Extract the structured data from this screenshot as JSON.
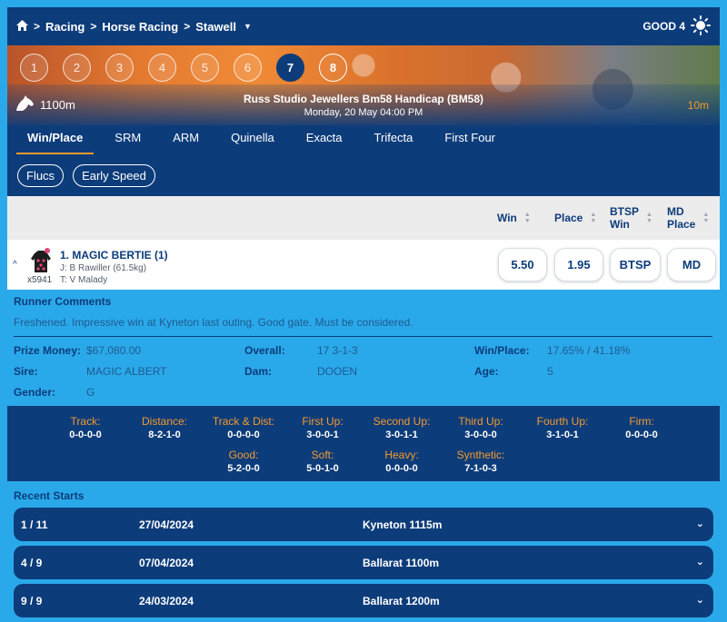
{
  "breadcrumb": {
    "items": [
      "Racing",
      "Horse Racing",
      "Stawell"
    ]
  },
  "track_condition": "GOOD 4",
  "race_numbers": [
    "1",
    "2",
    "3",
    "4",
    "5",
    "6",
    "7",
    "8"
  ],
  "active_race": "7",
  "race": {
    "distance": "1100m",
    "title": "Russ Studio Jewellers Bm58 Handicap (BM58)",
    "datetime": "Monday, 20 May 04:00 PM",
    "countdown": "10m"
  },
  "tabs": [
    "Win/Place",
    "SRM",
    "ARM",
    "Quinella",
    "Exacta",
    "Trifecta",
    "First Four"
  ],
  "filters": [
    "Flucs",
    "Early Speed"
  ],
  "odds_headers": {
    "win": "Win",
    "place": "Place",
    "btsp_1": "BTSP",
    "btsp_2": "Win",
    "md_1": "MD",
    "md_2": "Place"
  },
  "runner": {
    "name": "1. MAGIC BERTIE (1)",
    "jockey": "J: B Rawiller (61.5kg)",
    "trainer": "T: V Malady",
    "id": "x5941",
    "odds": {
      "win": "5.50",
      "place": "1.95",
      "btsp": "BTSP",
      "md": "MD"
    }
  },
  "comments": {
    "title": "Runner Comments",
    "text": "Freshened. Impressive win at Kyneton last outing. Good gate. Must be considered."
  },
  "details": {
    "prize_money_label": "Prize Money:",
    "prize_money": "$67,080.00",
    "overall_label": "Overall:",
    "overall": "17 3-1-3",
    "winplace_label": "Win/Place:",
    "winplace": "17.65% / 41.18%",
    "sire_label": "Sire:",
    "sire": "MAGIC ALBERT",
    "dam_label": "Dam:",
    "dam": "DOOEN",
    "age_label": "Age:",
    "age": "5",
    "gender_label": "Gender:",
    "gender": "G"
  },
  "stats": [
    {
      "label": "Track:",
      "value": "0-0-0-0"
    },
    {
      "label": "Distance:",
      "value": "8-2-1-0"
    },
    {
      "label": "Track & Dist:",
      "value": "0-0-0-0"
    },
    {
      "label": "First Up:",
      "value": "3-0-0-1"
    },
    {
      "label": "Second Up:",
      "value": "3-0-1-1"
    },
    {
      "label": "Third Up:",
      "value": "3-0-0-0"
    },
    {
      "label": "Fourth Up:",
      "value": "3-1-0-1"
    },
    {
      "label": "Firm:",
      "value": "0-0-0-0"
    },
    {
      "label": "Good:",
      "value": "5-2-0-0"
    },
    {
      "label": "Soft:",
      "value": "5-0-1-0"
    },
    {
      "label": "Heavy:",
      "value": "0-0-0-0"
    },
    {
      "label": "Synthetic:",
      "value": "7-1-0-3"
    }
  ],
  "recent_starts": {
    "title": "Recent Starts",
    "rows": [
      {
        "position": "1 / 11",
        "date": "27/04/2024",
        "venue": "Kyneton 1115m"
      },
      {
        "position": "4 / 9",
        "date": "07/04/2024",
        "venue": "Ballarat 1100m"
      },
      {
        "position": "9 / 9",
        "date": "24/03/2024",
        "venue": "Ballarat 1200m"
      }
    ]
  },
  "colors": {
    "navy": "#0d3c7a",
    "sky": "#2aa9ea",
    "accent": "#f39a2d"
  }
}
